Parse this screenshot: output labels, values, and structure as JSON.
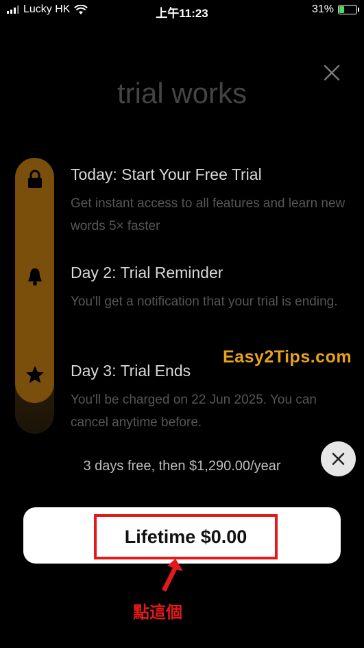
{
  "status_bar": {
    "carrier": "Lucky HK",
    "time": "上午11:23",
    "battery": "31%",
    "battery_level": 0.31
  },
  "heading": "trial works",
  "steps": [
    {
      "title": "Today: Start Your Free Trial",
      "description": "Get instant access to all features and learn new words 5× faster",
      "icon": "lock-icon"
    },
    {
      "title": "Day 2: Trial Reminder",
      "description": "You'll get a notification that your trial is ending.",
      "icon": "bell-icon"
    },
    {
      "title": "Day 3: Trial Ends",
      "description": "You'll be charged on 22 Jun 2025. You can cancel anytime before.",
      "icon": "star-icon"
    }
  ],
  "watermark": "Easy2Tips.com",
  "price_text": "3 days free, then $1,290.00/year",
  "cta_label": "Lifetime $0.00",
  "annotation": "點這個",
  "colors": {
    "background": "#000000",
    "timeline": "#7a4e0b",
    "highlight": "#e21a1a",
    "watermark": "#e8a21a"
  }
}
